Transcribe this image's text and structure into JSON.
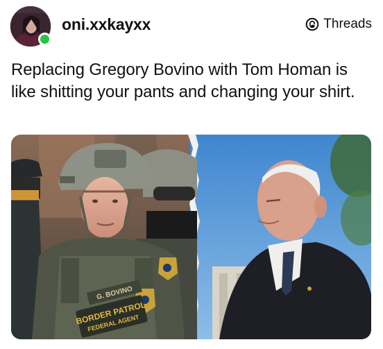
{
  "post": {
    "username": "oni.xxkayxx",
    "brand_label": "Threads",
    "text": "Replacing Gregory Bovino with Tom Homan is like shitting your pants and changing your shirt."
  },
  "image": {
    "nametape": "G. BOVINO",
    "patch_line1": "BORDER PATROL",
    "patch_line2": "FEDERAL AGENT"
  },
  "icons": {
    "brand": "threads-logo-icon",
    "status": "online-status-dot"
  },
  "colors": {
    "online": "#29c440",
    "text": "#111111",
    "background": "#ffffff"
  }
}
